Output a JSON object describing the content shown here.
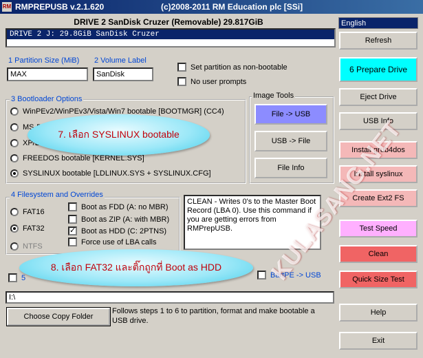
{
  "window": {
    "app_icon_text": "RM",
    "title": "RMPREPUSB v.2.1.620",
    "copyright": "(c)2008-2011 RM Education plc [SSi]"
  },
  "drive_header": "DRIVE 2 SanDisk Cruzer  (Removable) 29.817GiB",
  "drive_list": {
    "selected": "DRIVE 2   J:   29.8GiB  SanDisk Cruzer"
  },
  "language": "English",
  "partition": {
    "size_label": "1 Partition Size (MiB)",
    "size_value": "MAX",
    "volume_label": "2 Volume Label",
    "volume_value": "SanDisk",
    "non_bootable": "Set partition as non-bootable",
    "no_prompts": "No user prompts"
  },
  "bootloader": {
    "title": "3 Bootloader Options",
    "options": [
      "WinPEv2/WinPEv3/Vista/Win7 bootable [BOOTMGR] (CC4)",
      "MS-DOS",
      "XP/BartPE",
      "FREEDOS bootable [KERNEL.SYS]",
      "SYSLINUX bootable [LDLINUX.SYS + SYSLINUX.CFG]"
    ],
    "selected_index": 4
  },
  "image_tools": {
    "title": "Image Tools",
    "file_to_usb": "File -> USB",
    "usb_to_file": "USB -> File",
    "file_info": "File Info"
  },
  "filesystem": {
    "title": "4 Filesystem and Overrides",
    "fs": [
      "FAT16",
      "FAT32",
      "NTFS"
    ],
    "selected_fs": "FAT32",
    "overrides": [
      {
        "label": "Boot as FDD (A: no MBR)",
        "checked": false
      },
      {
        "label": "Boot as ZIP (A: with MBR)",
        "checked": false
      },
      {
        "label": "Boot as HDD (C: 2PTNS)",
        "checked": true
      },
      {
        "label": "Force use of LBA calls",
        "checked": false
      }
    ]
  },
  "description": "CLEAN - Writes 0's to the Master Boot Record (LBA 0). Use this command if you are getting errors from RMPrepUSB.",
  "copy_row": {
    "left_label": "5",
    "bartpe_label": "BartPE -> USB"
  },
  "path_value": "I:\\",
  "choose_copy_folder": "Choose Copy Folder",
  "follow_text": "Follows steps 1 to 6 to partition, format and make bootable a USB drive.",
  "right_buttons": {
    "refresh": "Refresh",
    "prepare": "6 Prepare Drive",
    "eject": "Eject Drive",
    "usb_info": "USB Info",
    "install_grub4dos": "Install grub4dos",
    "install_syslinux": "Install syslinux",
    "create_ext2": "Create Ext2 FS",
    "test_speed": "Test Speed",
    "clean": "Clean",
    "quick_size_test": "Quick Size Test",
    "help": "Help",
    "exit": "Exit"
  },
  "callouts": {
    "step7": "7. เลือก SYSLINUX bootable",
    "step8": "8. เลือก FAT32 และติ๊กถูกที่ Boot as HDD"
  },
  "watermark": "KULASANG.NET",
  "colors": {
    "titlebar": "#0a246a",
    "prepare": "#00ffff",
    "clean": "#f06464",
    "pink": "#f4b8b8",
    "file_to_usb": "#8c8cff",
    "callout_text": "#c0000a"
  }
}
